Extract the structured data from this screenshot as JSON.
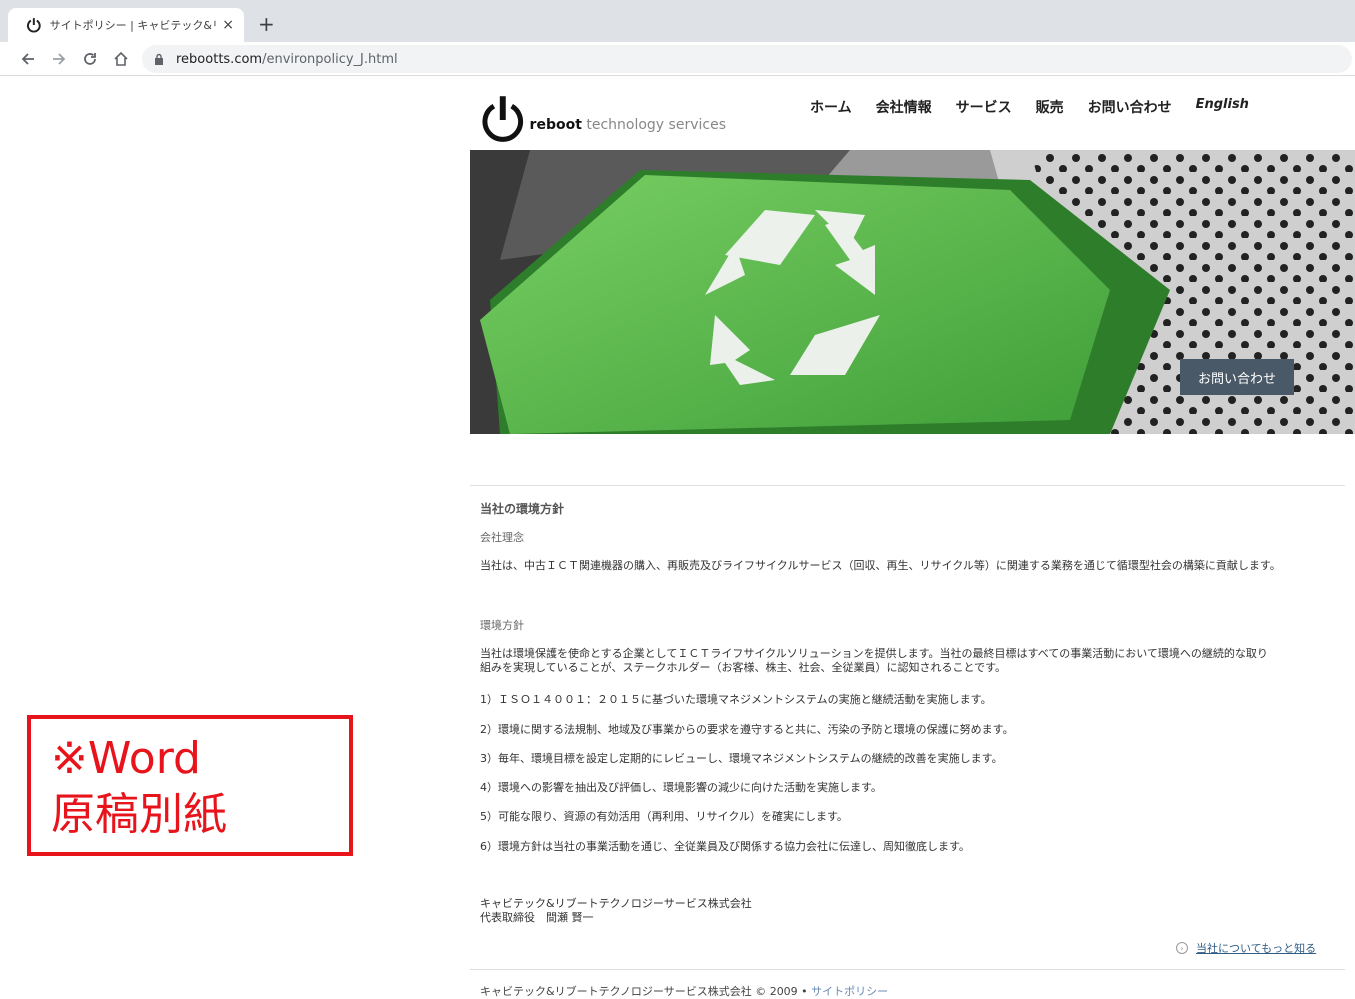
{
  "browser": {
    "tab_title": "サイトポリシー | キャビテック&リブートテ",
    "tab_close": "×",
    "new_tab": "+",
    "url_host": "rebootts.com",
    "url_path": "/environpolicy_J.html"
  },
  "header": {
    "logo_bold": "reboot",
    "logo_rest": " technology services",
    "nav": [
      "ホーム",
      "会社情報",
      "サービス",
      "販売",
      "お問い合わせ",
      "English"
    ]
  },
  "hero": {
    "contact_button": "お問い合わせ",
    "accent_color": "#5cbc4e"
  },
  "main": {
    "heading": "当社の環境方針",
    "philosophy_label": "会社理念",
    "philosophy_text": "当社は、中古ＩＣＴ関連機器の購入、再販売及びライフサイクルサービス（回収、再生、リサイクル等）に関連する業務を通じて循環型社会の構築に貢献します。",
    "policy_label": "環境方針",
    "policy_text": "当社は環境保護を使命とする企業としてＩＣＴライフサイクルソリューションを提供します。当社の最終目標はすべての事業活動において環境への継続的な取り組みを実現していることが、ステークホルダー（お客様、株主、社会、全従業員）に認知されることです。",
    "items": [
      "1）ＩＳＯ１４００１：２０１５に基づいた環境マネジメントシステムの実施と継続活動を実施します。",
      "2）環境に関する法規制、地域及び事業からの要求を遵守すると共に、汚染の予防と環境の保護に努めます。",
      "3）毎年、環境目標を設定し定期的にレビューし、環境マネジメントシステムの継続的改善を実施します。",
      "4）環境への影響を抽出及び評価し、環境影響の減少に向けた活動を実施します。",
      "5）可能な限り、資源の有効活用（再利用、リサイクル）を確実にします。",
      "6）環境方針は当社の事業活動を通じ、全従業員及び関係する協力会社に伝達し、周知徹底します。"
    ],
    "signature_company": "キャビテック&リブートテクノロジーサービス株式会社",
    "signature_person": "代表取締役　間瀬 賢一",
    "more_link": "当社についてもっと知る"
  },
  "footer": {
    "text": "キャビテック&リブートテクノロジーサービス株式会社 © 2009 • ",
    "link": "サイトポリシー"
  },
  "annotation": {
    "line1": "※Word",
    "line2": "原稿別紙",
    "color": "#e8141b"
  }
}
